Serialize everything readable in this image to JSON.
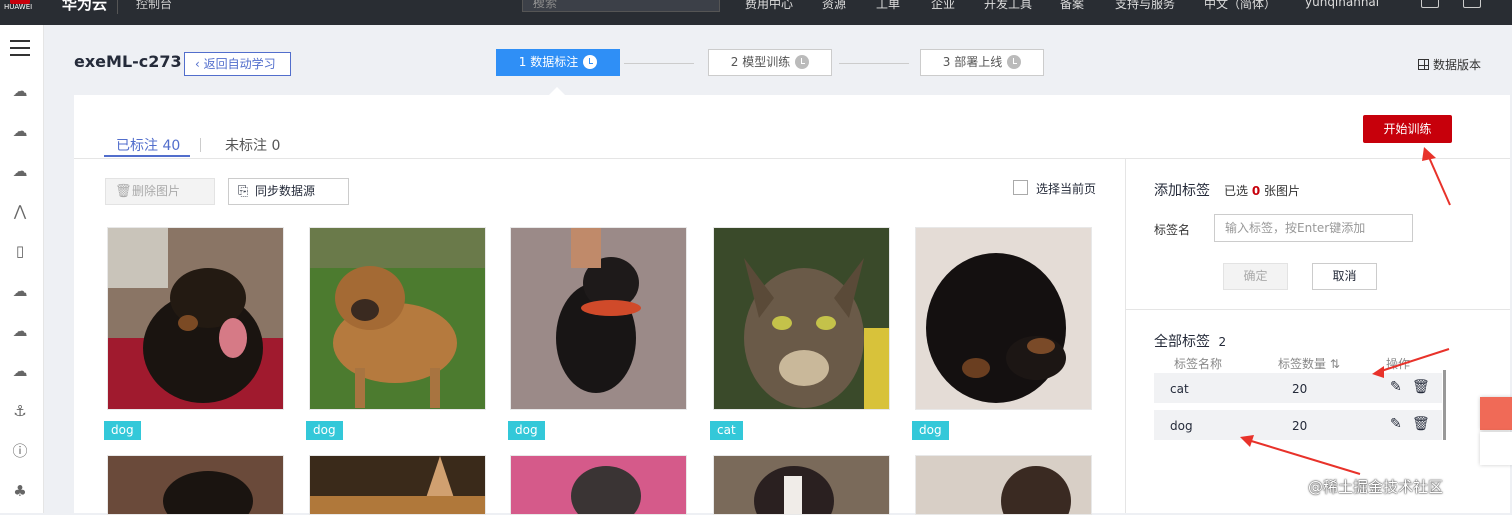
{
  "topbar": {
    "logo_text": "HUAWEI",
    "brand": "华为云",
    "console": "控制台",
    "search_placeholder": "搜索",
    "nav": [
      "费用中心",
      "资源",
      "工单",
      "企业",
      "开发工具",
      "备案",
      "支持与服务",
      "中文（简体）",
      "yunqinannai"
    ]
  },
  "header": {
    "job_title": "exeML-c273",
    "back_label": "返回自动学习",
    "steps": [
      "1 数据标注",
      "2 模型训练",
      "3 部署上线"
    ],
    "data_version": "数据版本"
  },
  "tabs": {
    "labeled": "已标注 40",
    "unlabeled": "未标注 0"
  },
  "toolbar": {
    "delete_label": "删除图片",
    "sync_label": "同步数据源",
    "select_page_label": "选择当前页"
  },
  "train_button": "开始训练",
  "images": [
    {
      "tag": "dog",
      "subject": "doberman"
    },
    {
      "tag": "dog",
      "subject": "boxer mix"
    },
    {
      "tag": "dog",
      "subject": "black lab"
    },
    {
      "tag": "cat",
      "subject": "tortoiseshell cat"
    },
    {
      "tag": "dog",
      "subject": "rottweiler puppy"
    }
  ],
  "side_panel": {
    "add_label_title": "添加标签",
    "selected_prefix": "已选",
    "selected_count": "0",
    "selected_suffix": "张图片",
    "label_name": "标签名",
    "input_placeholder": "输入标签，按Enter键添加",
    "confirm": "确定",
    "cancel": "取消",
    "all_labels_title": "全部标签",
    "all_labels_count": "2",
    "col_name": "标签名称",
    "col_count": "标签数量",
    "col_action": "操作",
    "labels": [
      {
        "name": "cat",
        "count": "20"
      },
      {
        "name": "dog",
        "count": "20"
      }
    ]
  },
  "watermark": "@稀土掘金技术社区",
  "colors": {
    "accent": "#526ecc",
    "primary_blue": "#2f8ff6",
    "brand_red": "#c7000b",
    "tag_cyan": "#33c8d9",
    "annotation_red": "#e8322a"
  }
}
